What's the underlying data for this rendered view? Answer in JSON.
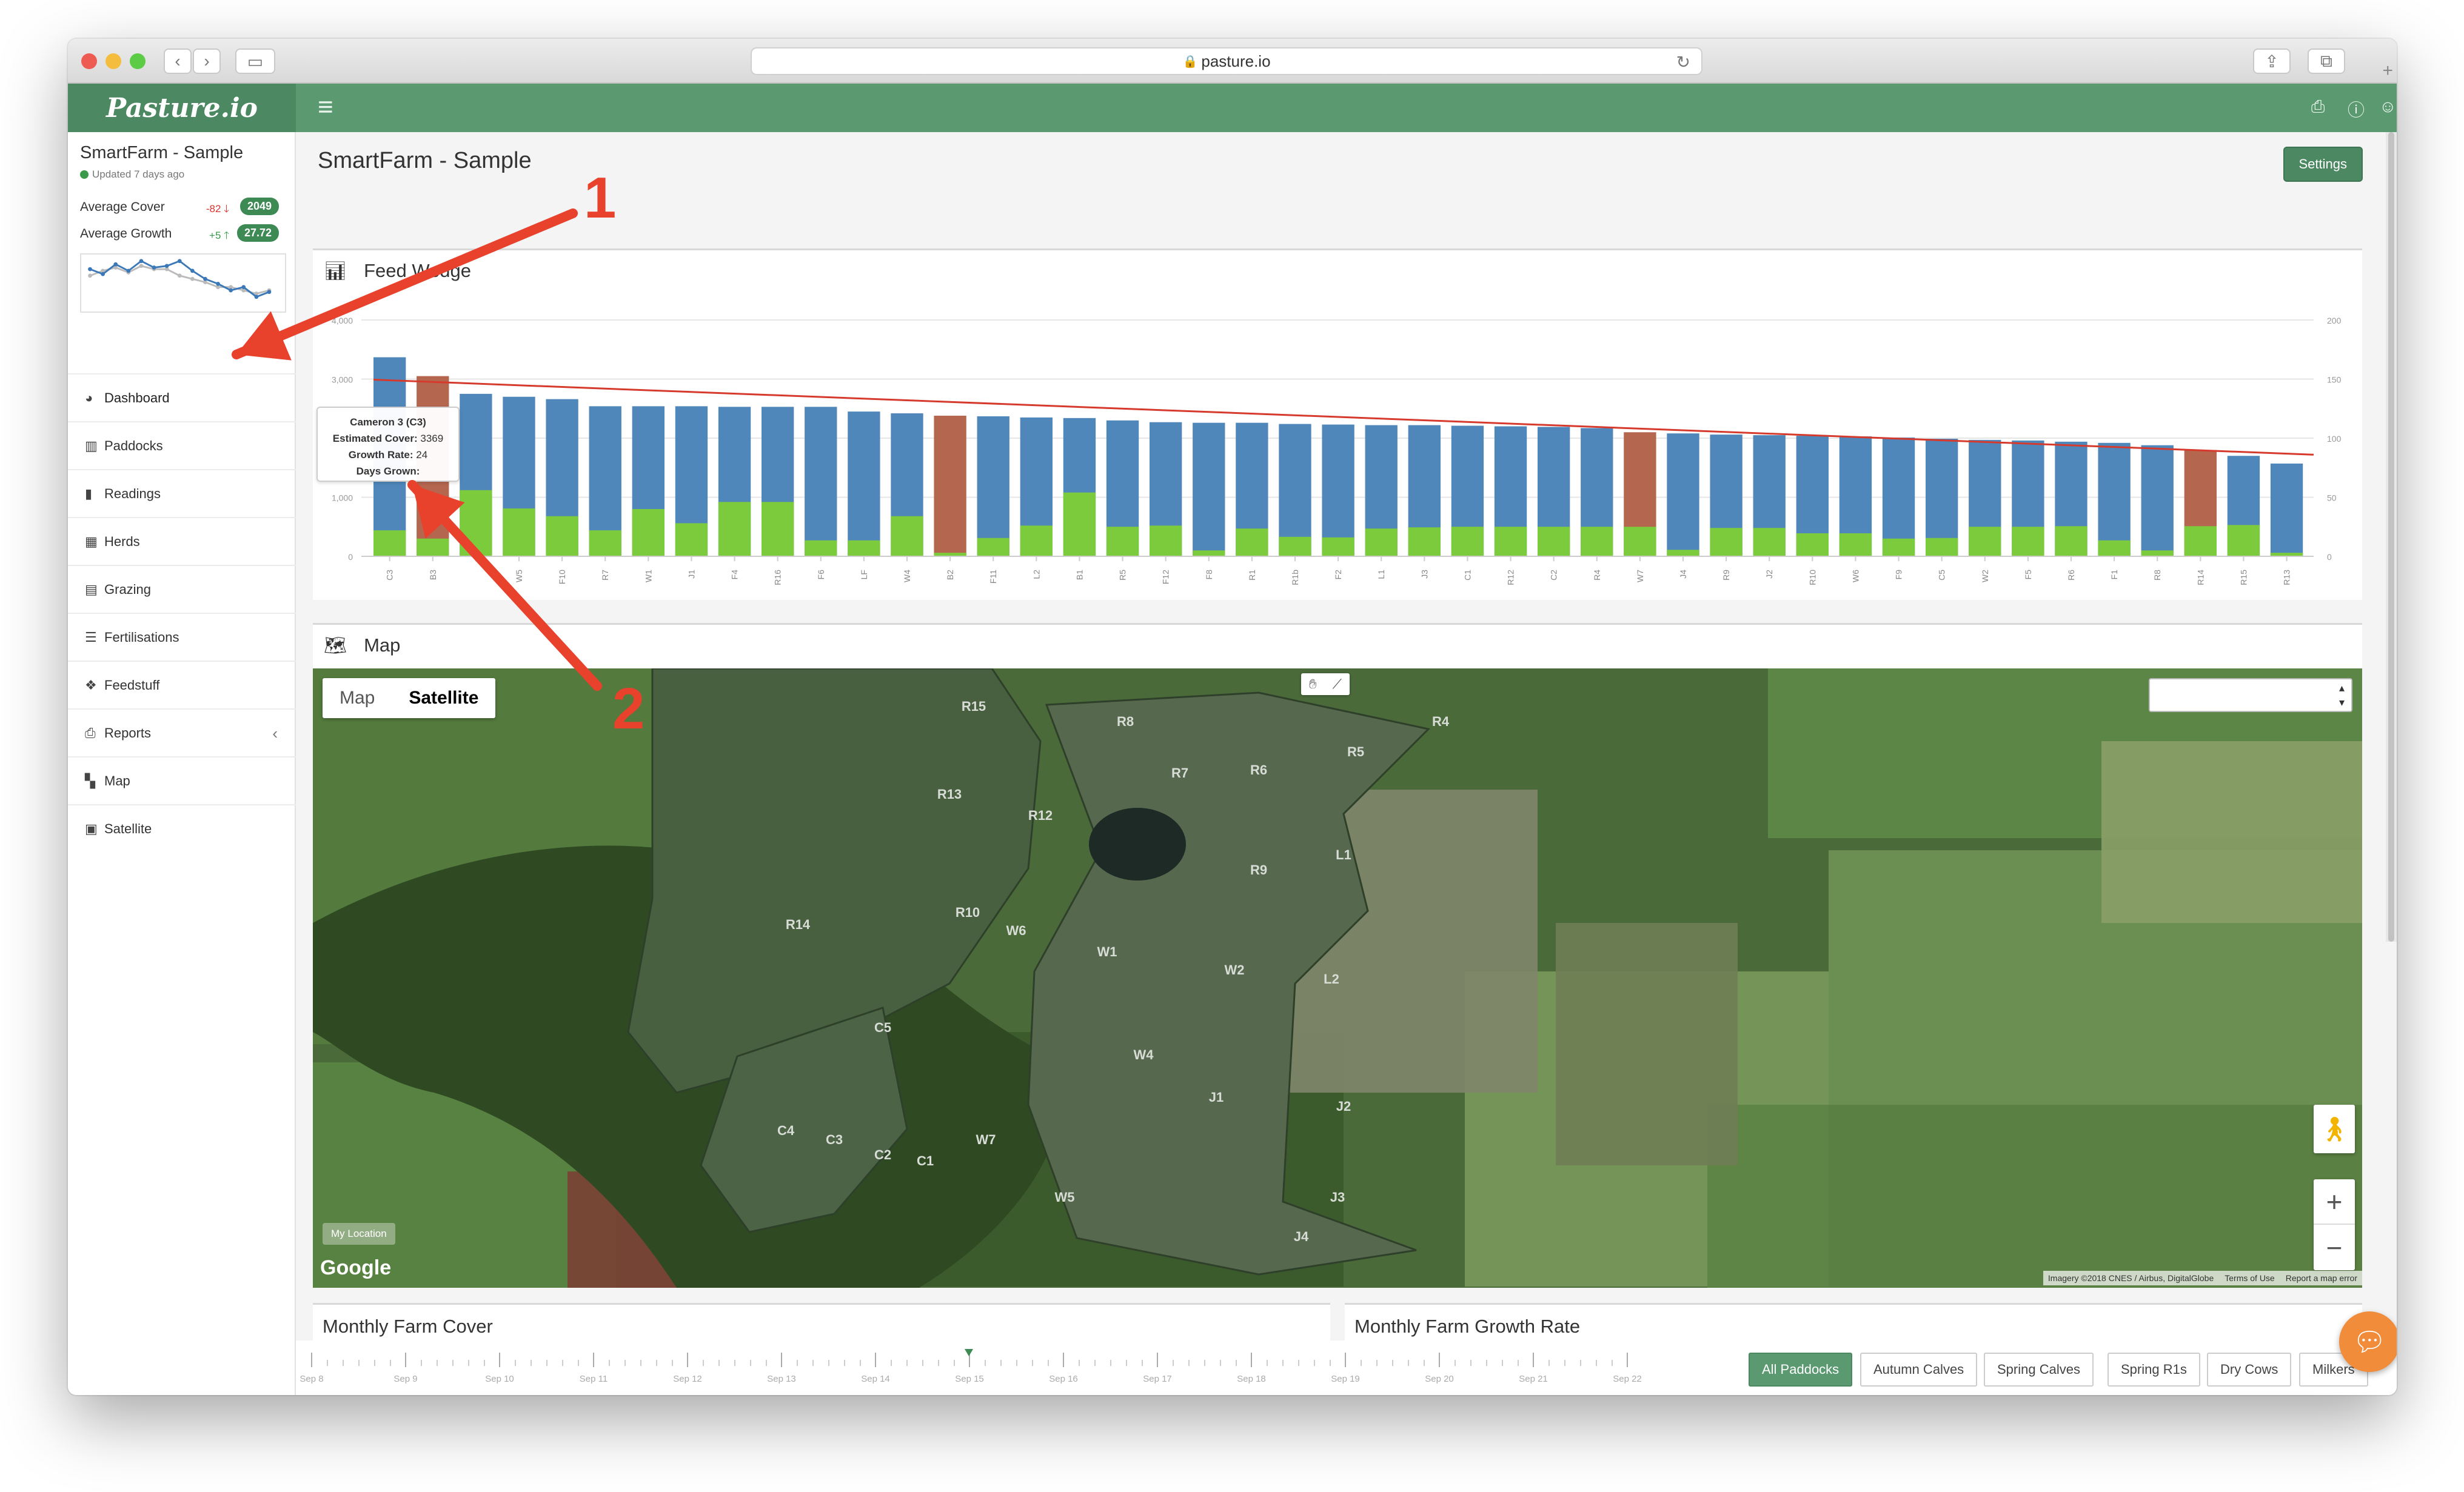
{
  "browser": {
    "url": "pasture.io"
  },
  "app": {
    "logo": "Pasture.io"
  },
  "sidebar": {
    "farm_name": "SmartFarm - Sample",
    "updated": "Updated 7 days ago",
    "stats": [
      {
        "label": "Average Cover",
        "delta": "-82",
        "value": "2049"
      },
      {
        "label": "Average Growth",
        "delta": "+5",
        "value": "27.72"
      }
    ],
    "sparkline": [
      52,
      46,
      58,
      50,
      62,
      54,
      56,
      62,
      50,
      40,
      34,
      26,
      30,
      18,
      24
    ],
    "sparkline2": [
      44,
      50,
      54,
      48,
      56,
      52,
      52,
      44,
      40,
      36,
      30,
      30,
      26,
      22,
      26
    ],
    "nav": [
      {
        "label": "Dashboard",
        "icon": "dashboard-icon"
      },
      {
        "label": "Paddocks",
        "icon": "paddocks-icon"
      },
      {
        "label": "Readings",
        "icon": "bar-chart-icon"
      },
      {
        "label": "Herds",
        "icon": "grid-icon"
      },
      {
        "label": "Grazing",
        "icon": "calendar-icon"
      },
      {
        "label": "Fertilisations",
        "icon": "list-icon"
      },
      {
        "label": "Feedstuff",
        "icon": "cubes-icon"
      },
      {
        "label": "Reports",
        "icon": "print-icon"
      },
      {
        "label": "Map",
        "icon": "map-icon"
      },
      {
        "label": "Satellite",
        "icon": "image-icon"
      }
    ]
  },
  "page": {
    "title": "SmartFarm - Sample",
    "settings_label": "Settings"
  },
  "feed_wedge": {
    "title": "Feed Wedge",
    "tooltip": {
      "title": "Cameron 3 (C3)",
      "cover_label": "Estimated Cover:",
      "cover_value": "3369",
      "growth_label": "Growth Rate:",
      "growth_value": "24",
      "days_label": "Days Grown:",
      "days_value": ""
    }
  },
  "chart_data": {
    "type": "bar",
    "categories": [
      "C3",
      "B3",
      "",
      "W5",
      "F10",
      "R7",
      "W1",
      "J1",
      "F4",
      "R16",
      "F6",
      "LF",
      "W4",
      "B2",
      "F11",
      "L2",
      "B1",
      "R5",
      "F12",
      "F8",
      "R1",
      "R1b",
      "F2",
      "L1",
      "J3",
      "C1",
      "R12",
      "C2",
      "R4",
      "W7",
      "J4",
      "R9",
      "J2",
      "R10",
      "W6",
      "F9",
      "C5",
      "W2",
      "F5",
      "R6",
      "F1",
      "R8",
      "R14",
      "R15",
      "R13"
    ],
    "series": [
      {
        "values": [
          3369,
          3050,
          2750,
          2700,
          2660,
          2540,
          2540,
          2540,
          2530,
          2530,
          2530,
          2450,
          2420,
          2380,
          2370,
          2350,
          2340,
          2300,
          2270,
          2260,
          2260,
          2240,
          2230,
          2220,
          2220,
          2210,
          2200,
          2190,
          2170,
          2100,
          2080,
          2060,
          2050,
          2040,
          2030,
          2010,
          1990,
          1970,
          1960,
          1940,
          1920,
          1880,
          1800,
          1700,
          1570
        ]
      },
      {
        "values": [
          440,
          300,
          1120,
          810,
          680,
          440,
          800,
          560,
          920,
          920,
          270,
          270,
          680,
          60,
          310,
          520,
          1080,
          500,
          520,
          100,
          470,
          330,
          320,
          470,
          490,
          500,
          500,
          500,
          500,
          500,
          110,
          480,
          480,
          390,
          390,
          300,
          310,
          500,
          500,
          510,
          270,
          100,
          510,
          530,
          60
        ]
      },
      {
        "values": [
          null,
          null,
          null,
          null,
          null,
          null,
          null,
          null,
          null,
          null,
          null,
          null,
          null,
          null,
          null,
          null,
          null,
          null,
          null,
          null,
          null,
          null,
          null,
          null,
          null,
          null,
          null,
          null,
          null,
          null,
          null,
          null,
          null,
          null,
          null,
          null,
          null,
          null,
          null,
          null,
          null,
          null,
          null,
          null,
          null
        ]
      }
    ],
    "highlight_indices": [
      1,
      13,
      29,
      42
    ],
    "target_line": [
      2990,
      1720
    ],
    "ylim": [
      0,
      4000
    ],
    "yticks": [
      "0",
      "1,000",
      "2,000",
      "3,000",
      "4,000"
    ],
    "y2ticks": [
      "0",
      "50",
      "100",
      "150",
      "200"
    ],
    "colors": {
      "cover": "#4f87bb",
      "growth": "#7ccb3c",
      "highlight": "#b5664f",
      "target": "#d63a2c"
    }
  },
  "map": {
    "title": "Map",
    "toggle": [
      "Map",
      "Satellite"
    ],
    "selected_toggle": "Satellite",
    "my_location": "My Location",
    "google": "Google",
    "attribution": [
      "Imagery ©2018 CNES / Airbus, DigitalGlobe",
      "Terms of Use",
      "Report a map error"
    ],
    "paddocks": [
      "R15",
      "R8",
      "R4",
      "R7",
      "R6",
      "R5",
      "R13",
      "R12",
      "R9",
      "L1",
      "R14",
      "R10",
      "W6",
      "W1",
      "W2",
      "L2",
      "C5",
      "W4",
      "J1",
      "J2",
      "C4",
      "C3",
      "C2",
      "C1",
      "W7",
      "W5",
      "J3",
      "J4"
    ]
  },
  "bottom": {
    "monthly_cover": "Monthly Farm Cover",
    "monthly_growth": "Monthly Farm Growth Rate"
  },
  "timeline": {
    "dates": [
      "Sep 8",
      "Sep 9",
      "Sep 10",
      "Sep 11",
      "Sep 12",
      "Sep 13",
      "Sep 14",
      "Sep 15",
      "Sep 16",
      "Sep 17",
      "Sep 18",
      "Sep 19",
      "Sep 20",
      "Sep 21",
      "Sep 22"
    ],
    "tabs": [
      "All Paddocks",
      "Autumn Calves",
      "Spring Calves",
      "Spring R1s",
      "Dry Cows",
      "Milkers"
    ],
    "selected_tab": "All Paddocks"
  },
  "annotations": [
    "1",
    "2"
  ]
}
